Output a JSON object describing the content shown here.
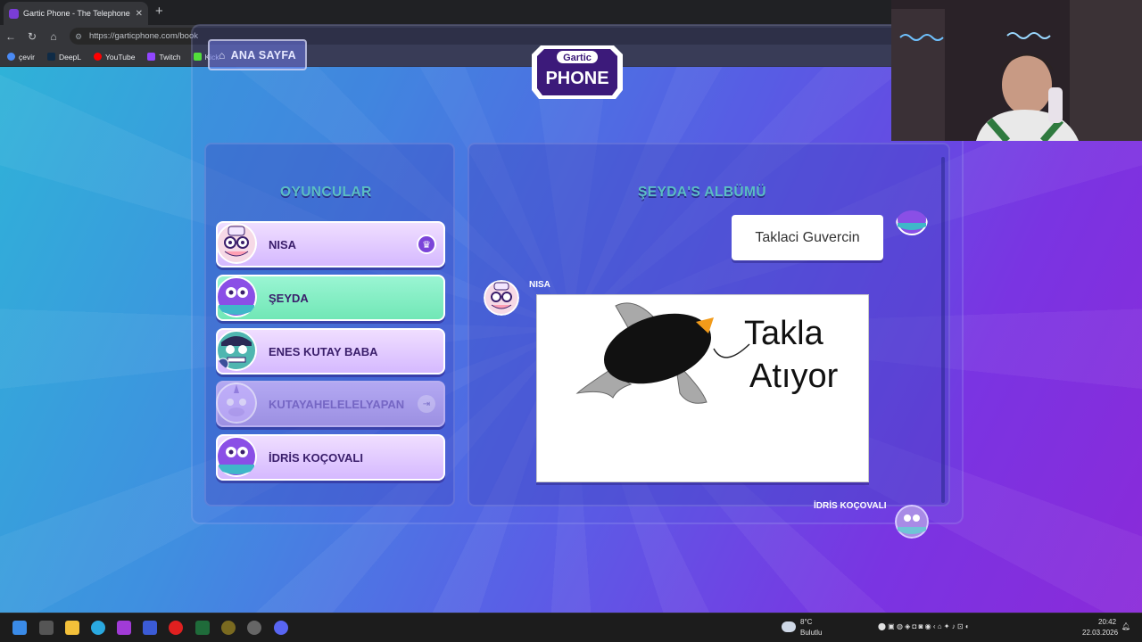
{
  "browser": {
    "tab_title": "Gartic Phone - The Telephone Gam",
    "tab_close": "✕",
    "new_tab": "+",
    "url": "https://garticphone.com/book",
    "bookmarks": [
      {
        "label": "çevir",
        "color": "#4a8af4"
      },
      {
        "label": "DeepL",
        "color": "#0f2b46"
      },
      {
        "label": "YouTube",
        "color": "#ff0000"
      },
      {
        "label": "Twitch",
        "color": "#9146ff"
      },
      {
        "label": "Kick",
        "color": "#53fc18"
      }
    ]
  },
  "game": {
    "home_button": "ANA SAYFA",
    "logo_top": "Gartic",
    "logo_bottom": "PHONE",
    "players_heading": "OYUNCULAR",
    "album_heading": "ŞEYDA'S ALBÜMÜ",
    "players": [
      {
        "name": "NISA",
        "state": "host",
        "badge_icon": "♛"
      },
      {
        "name": "ŞEYDA",
        "state": "current"
      },
      {
        "name": "ENES KUTAY BABA",
        "state": "normal"
      },
      {
        "name": "KUTAYAHELELELYAPAN",
        "state": "left",
        "badge_icon": "⇥"
      },
      {
        "name": "İDRİS KOÇOVALI",
        "state": "normal"
      }
    ],
    "album": {
      "prompt_text": "Taklaci Guvercin",
      "drawing_author": "NISA",
      "drawing_text_line1": "Takla",
      "drawing_text_line2": "Atıyor",
      "next_author": "İDRİS KOÇOVALI"
    }
  },
  "taskbar": {
    "weather_temp": "8°C",
    "weather_desc": "Bulutlu",
    "time": "20:42",
    "date": "22.03.2026"
  }
}
